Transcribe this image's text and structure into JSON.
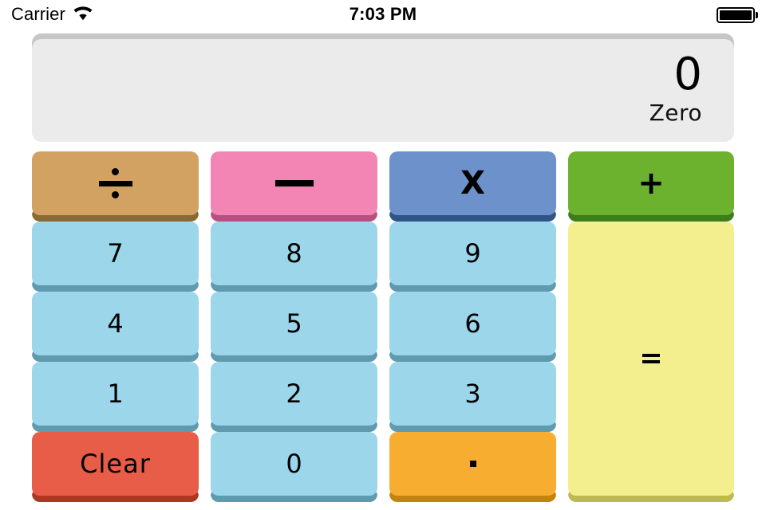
{
  "status_bar": {
    "carrier": "Carrier",
    "wifi_icon": "wifi-icon",
    "time": "7:03 PM",
    "battery_icon": "battery-full-icon"
  },
  "display": {
    "value": "0",
    "words": "Zero",
    "background": "#ebebeb",
    "top_shadow": "#c6c6c6"
  },
  "keys": {
    "divide": {
      "label": "÷",
      "icon": "divide-icon",
      "face": "#d2a263",
      "edge": "#8a6a34"
    },
    "minus": {
      "label": "−",
      "icon": "minus-icon",
      "face": "#f285b4",
      "edge": "#b8507f"
    },
    "multiply": {
      "label": "X",
      "icon": "multiply-icon",
      "face": "#6d91ca",
      "edge": "#2f5486"
    },
    "plus": {
      "label": "+",
      "icon": "plus-icon",
      "face": "#6cb22e",
      "edge": "#3c7d1c"
    },
    "seven": {
      "label": "7",
      "face": "#9bd6ea",
      "edge": "#5f9aae"
    },
    "eight": {
      "label": "8",
      "face": "#9bd6ea",
      "edge": "#5f9aae"
    },
    "nine": {
      "label": "9",
      "face": "#9bd6ea",
      "edge": "#5f9aae"
    },
    "four": {
      "label": "4",
      "face": "#9bd6ea",
      "edge": "#5f9aae"
    },
    "five": {
      "label": "5",
      "face": "#9bd6ea",
      "edge": "#5f9aae"
    },
    "six": {
      "label": "6",
      "face": "#9bd6ea",
      "edge": "#5f9aae"
    },
    "one": {
      "label": "1",
      "face": "#9bd6ea",
      "edge": "#5f9aae"
    },
    "two": {
      "label": "2",
      "face": "#9bd6ea",
      "edge": "#5f9aae"
    },
    "three": {
      "label": "3",
      "face": "#9bd6ea",
      "edge": "#5f9aae"
    },
    "clear": {
      "label": "Clear",
      "face": "#e75d48",
      "edge": "#b03623"
    },
    "zero": {
      "label": "0",
      "face": "#9bd6ea",
      "edge": "#5f9aae"
    },
    "decimal": {
      "label": ".",
      "icon": "decimal-point-icon",
      "face": "#f6ad30",
      "edge": "#c4820e"
    },
    "equals": {
      "label": "=",
      "icon": "equals-icon",
      "face": "#f3ee8e",
      "edge": "#bfb952"
    }
  }
}
